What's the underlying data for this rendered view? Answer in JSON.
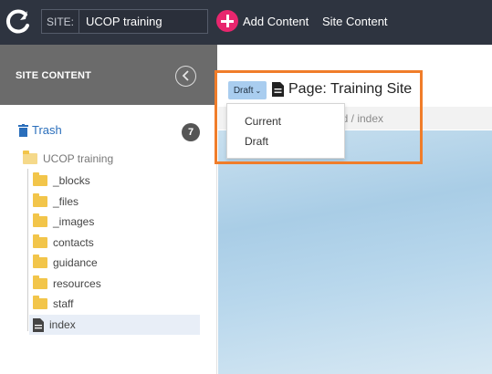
{
  "topbar": {
    "logo_icon": "cascade-logo-icon",
    "site_tag": "SITE:",
    "site_name": "UCOP training",
    "add_content_label": "Add Content",
    "add_content_icon": "plus-circle-icon",
    "add_content_color": "#e8266e",
    "site_content_link": "Site Content"
  },
  "sidebar": {
    "title": "SITE CONTENT",
    "collapse_icon": "chevron-left-icon",
    "trash_label": "Trash",
    "trash_count": "7",
    "root": "UCOP training",
    "items": [
      {
        "label": "_blocks",
        "icon": "folder-icon"
      },
      {
        "label": "_files",
        "icon": "folder-icon"
      },
      {
        "label": "_images",
        "icon": "folder-icon"
      },
      {
        "label": "contacts",
        "icon": "folder-icon"
      },
      {
        "label": "guidance",
        "icon": "folder-icon"
      },
      {
        "label": "resources",
        "icon": "folder-icon"
      },
      {
        "label": "staff",
        "icon": "folder-icon"
      },
      {
        "label": "index",
        "icon": "page-icon",
        "selected": true
      }
    ]
  },
  "main": {
    "version_button": "Draft",
    "page_title": "Page: Training Site",
    "breadcrumb": "ld / index",
    "version_menu": [
      "Current",
      "Draft"
    ]
  },
  "colors": {
    "topbar": "#2e3440",
    "sidebar_header": "#6b6b6b",
    "highlight": "#f07d2a",
    "link": "#2a6ebb"
  }
}
